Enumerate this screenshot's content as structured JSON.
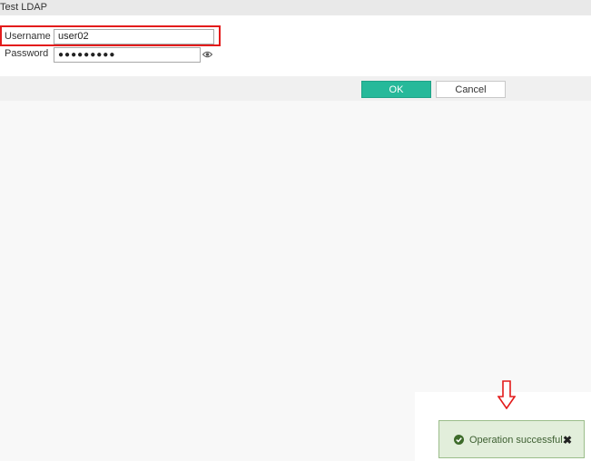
{
  "dialog": {
    "title": "Test LDAP"
  },
  "form": {
    "username_label": "Username",
    "username_value": "user02",
    "password_label": "Password",
    "password_value": "●●●●●●●●●"
  },
  "buttons": {
    "ok_label": "OK",
    "cancel_label": "Cancel"
  },
  "toast": {
    "message": "Operation successful.",
    "close_glyph": "✖"
  },
  "colors": {
    "ok_button": "#26b99a",
    "highlight_border": "#e31b1b",
    "toast_bg": "#e2eedb",
    "toast_text": "#3d5f31"
  },
  "icons": {
    "password_toggle": "eye-icon",
    "toast_status": "check-circle-icon",
    "annotation": "down-arrow-icon"
  }
}
